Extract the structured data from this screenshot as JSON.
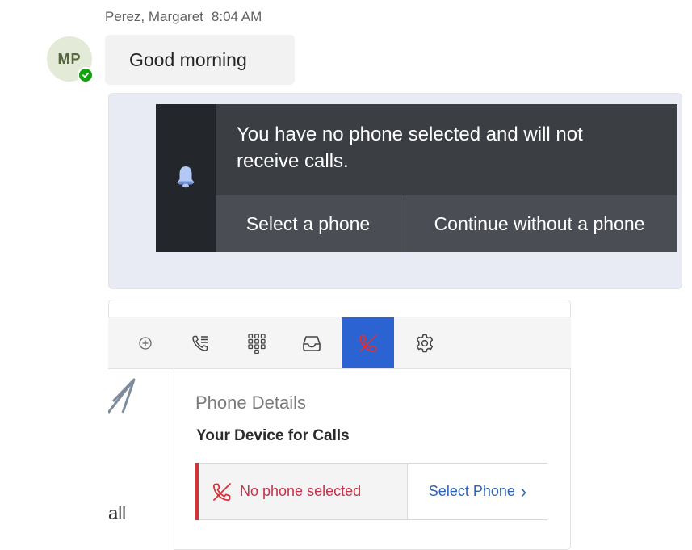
{
  "message": {
    "sender": "Perez, Margaret",
    "time": "8:04 AM",
    "avatar_initials": "MP",
    "presence": "available",
    "text": "Good morning"
  },
  "banner": {
    "icon": "bell-icon",
    "message": "You have no phone selected and will not receive calls.",
    "select_button": "Select a phone",
    "continue_button": "Continue without a phone"
  },
  "phone_panel": {
    "toolbar_icons": [
      "add-circle-icon",
      "call-list-icon",
      "dialpad-icon",
      "inbox-icon",
      "phone-off-icon",
      "gear-icon"
    ],
    "active_icon": "phone-off-icon",
    "sidebar_partial_text": "all",
    "details_title": "Phone Details",
    "device_label": "Your Device for Calls",
    "status_text": "No phone selected",
    "select_link": "Select Phone",
    "select_link_chevron": "›"
  },
  "colors": {
    "accent": "#2b63d2",
    "error": "#c4314b",
    "banner_bg": "#3b3e43",
    "presence": "#13a10e"
  }
}
